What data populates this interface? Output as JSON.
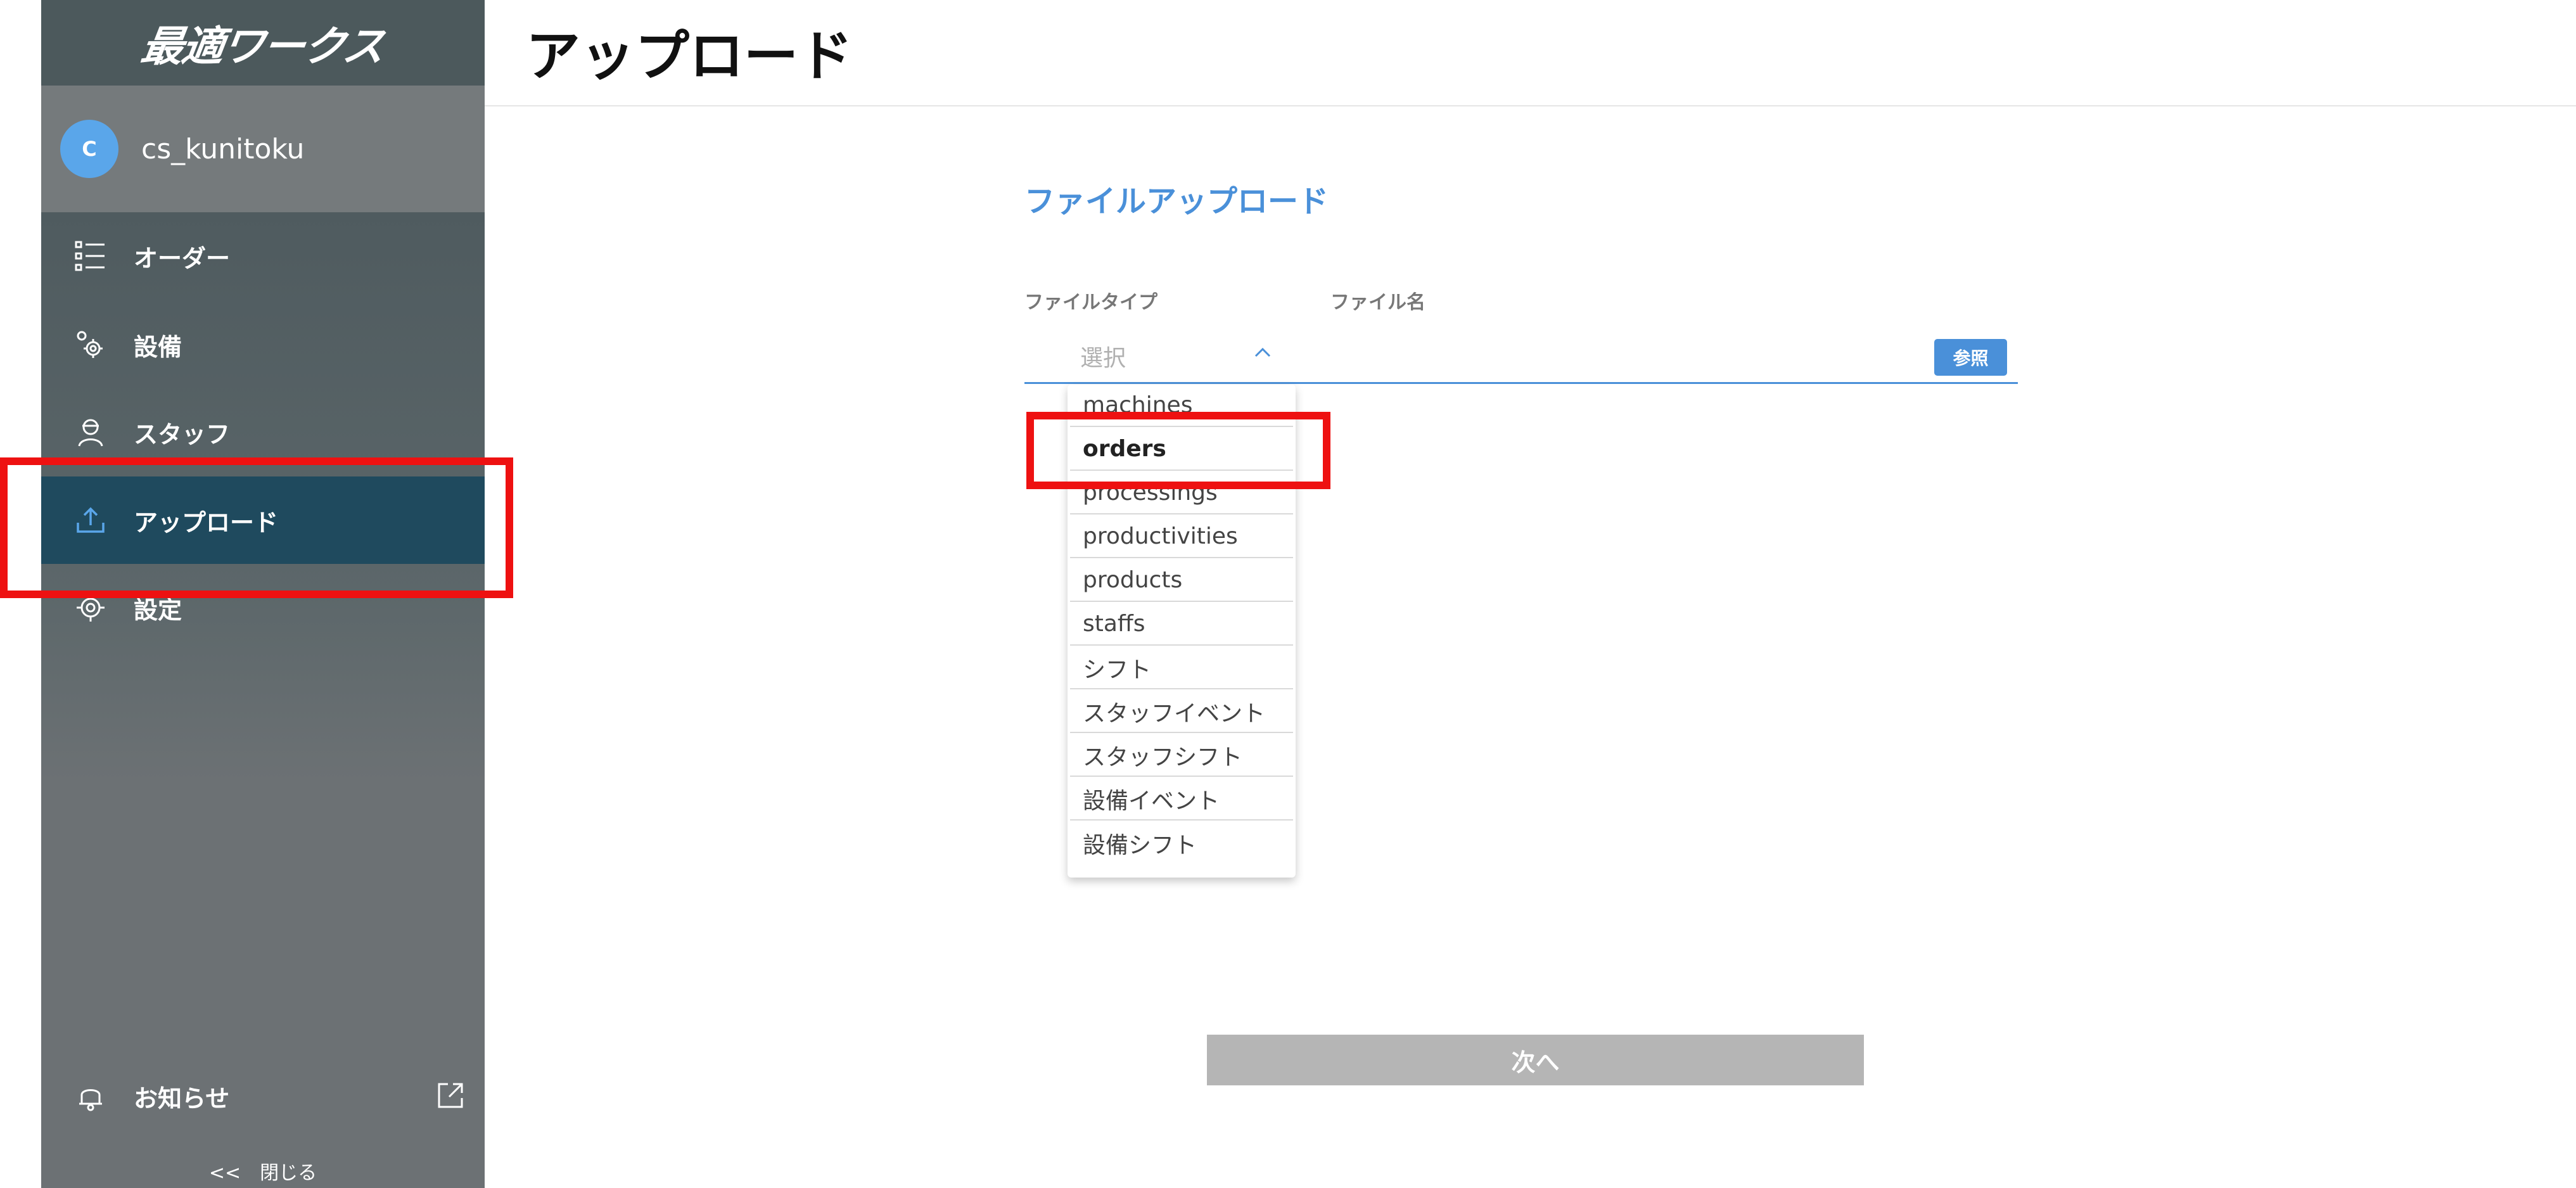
{
  "sidebar": {
    "logo_text": "最適ワークス",
    "user": {
      "avatar_initial": "C",
      "name": "cs_kunitoku"
    },
    "items": [
      {
        "label": "オーダー",
        "icon": "list-icon"
      },
      {
        "label": "設備",
        "icon": "gears-icon"
      },
      {
        "label": "スタッフ",
        "icon": "staff-icon"
      },
      {
        "label": "アップロード",
        "icon": "upload-icon",
        "active": true
      },
      {
        "label": "設定",
        "icon": "settings-gear-icon"
      }
    ],
    "notice_label": "お知らせ",
    "close_label": "<<　閉じる"
  },
  "main": {
    "page_title": "アップロード",
    "section_title": "ファイルアップロード",
    "file_type_label": "ファイルタイプ",
    "file_name_label": "ファイル名",
    "select_placeholder": "選択",
    "browse_label": "参照",
    "next_label": "次へ",
    "dropdown_options": [
      "machines",
      "orders",
      "processings",
      "productivities",
      "products",
      "staffs",
      "シフト",
      "スタッフイベント",
      "スタッフシフト",
      "設備イベント",
      "設備シフト"
    ],
    "highlighted_option": "orders"
  },
  "colors": {
    "sidebar_bg": "#6c7174",
    "sidebar_active": "#1f4a5e",
    "accent": "#4a90d9",
    "annotation_red": "#ee1111",
    "disabled_button": "#b5b5b5"
  }
}
